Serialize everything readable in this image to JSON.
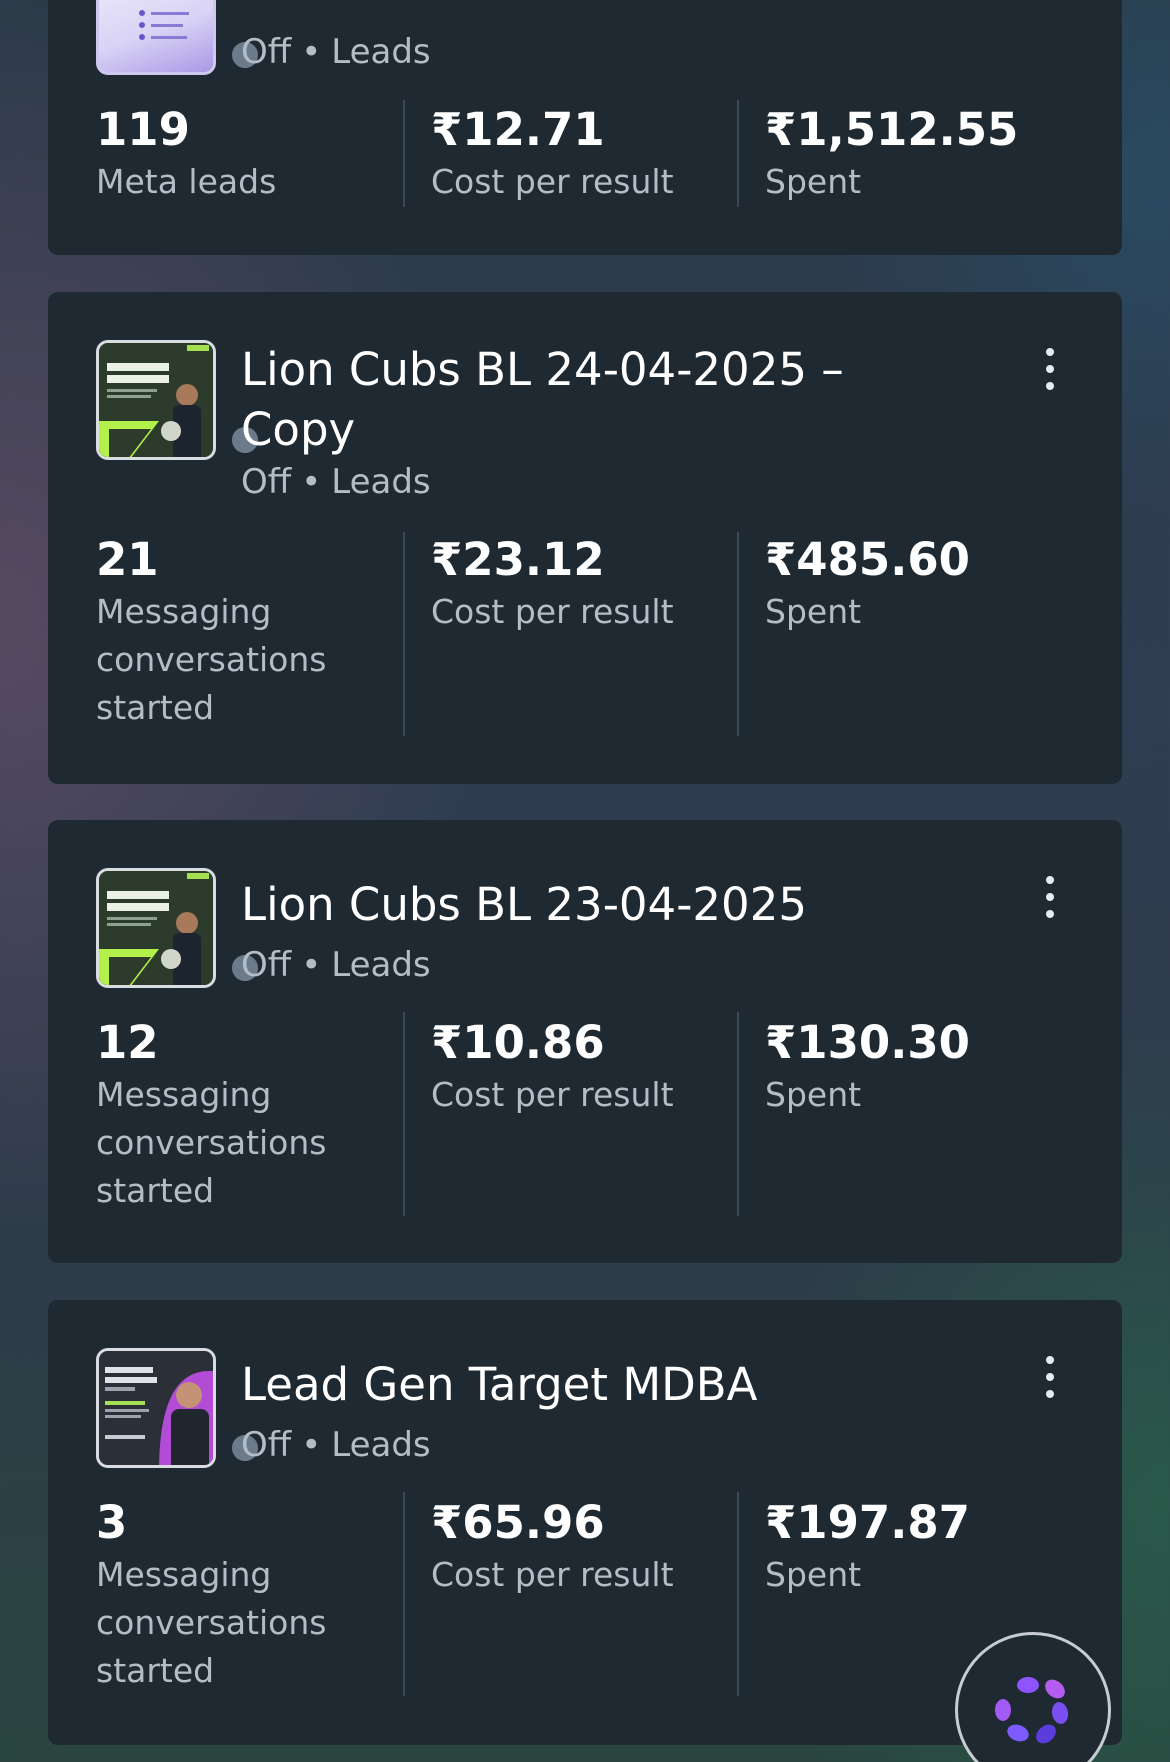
{
  "campaigns": [
    {
      "title": "",
      "status": "Off",
      "objective": "Leads",
      "separator": "•",
      "results": "119",
      "results_label": "Meta leads",
      "cost_per_result": "₹12.71",
      "cost_label": "Cost per result",
      "spent": "₹1,512.55",
      "spent_label": "Spent",
      "thumbnail": "lead-ad-creative-purple"
    },
    {
      "title": "Lion Cubs BL 24-04-2025 – Copy",
      "status": "Off",
      "objective": "Leads",
      "separator": "•",
      "results": "21",
      "results_label": "Messaging conversations started",
      "cost_per_result": "₹23.12",
      "cost_label": "Cost per result",
      "spent": "₹485.60",
      "spent_label": "Spent",
      "thumbnail": "business-loan-creative"
    },
    {
      "title": "Lion Cubs BL 23-04-2025",
      "status": "Off",
      "objective": "Leads",
      "separator": "•",
      "results": "12",
      "results_label": "Messaging conversations started",
      "cost_per_result": "₹10.86",
      "cost_label": "Cost per result",
      "spent": "₹130.30",
      "spent_label": "Spent",
      "thumbnail": "business-loan-creative"
    },
    {
      "title": "Lead Gen Target MDBA",
      "status": "Off",
      "objective": "Leads",
      "separator": "•",
      "results": "3",
      "results_label": "Messaging conversations started",
      "cost_per_result": "₹65.96",
      "cost_label": "Cost per result",
      "spent": "₹197.87",
      "spent_label": "Spent",
      "thumbnail": "grow-your-business-creative"
    }
  ],
  "icons": {
    "more": "more-vertical-icon",
    "assistant": "ai-assistant-icon"
  },
  "colors": {
    "card_bg": "#1f2932",
    "secondary_text": "#b4bcc6",
    "status_dot": "#6b7b8c"
  }
}
